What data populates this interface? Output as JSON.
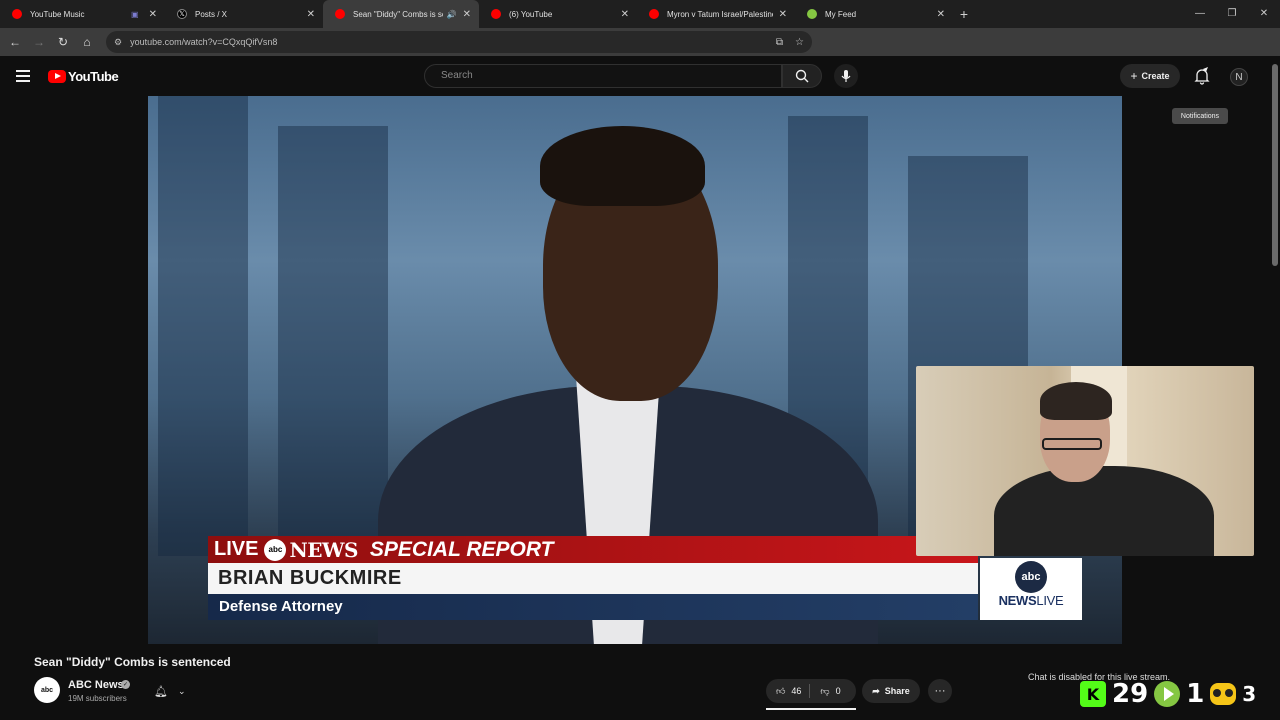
{
  "browser": {
    "tabs": [
      {
        "title": "YouTube Music",
        "icon": "youtube-music-icon",
        "color": "#ff0000",
        "active": false
      },
      {
        "title": "Posts / X",
        "icon": "x-icon",
        "color": "#ffffff",
        "active": false
      },
      {
        "title": "Sean \"Diddy\" Combs is sen",
        "icon": "youtube-icon",
        "color": "#ff0000",
        "active": true
      },
      {
        "title": "(6) YouTube",
        "icon": "youtube-icon",
        "color": "#ff0000",
        "active": false
      },
      {
        "title": "Myron v Tatum Israel/Palestine",
        "icon": "youtube-icon",
        "color": "#ff0000",
        "active": false
      },
      {
        "title": "My Feed",
        "icon": "rumble-icon",
        "color": "#85c742",
        "active": false
      }
    ],
    "url": "youtube.com/watch?v=CQxqQifVsn8"
  },
  "youtube": {
    "logo_text": "YouTube",
    "search_placeholder": "Search",
    "create_label": "Create",
    "avatar_letter": "N",
    "tooltip": "Notifications"
  },
  "video": {
    "lower_third": {
      "live": "LIVE",
      "abc": "abc",
      "news": "NEWS",
      "special": "SPECIAL REPORT",
      "name": "BRIAN BUCKMIRE",
      "role": "Defense Attorney",
      "badge_abc": "abc",
      "badge_news": "NEWS",
      "badge_live": "LIVE"
    }
  },
  "below": {
    "title": "Sean \"Diddy\" Combs is sentenced",
    "channel_avatar": "abc",
    "channel_name": "ABC News",
    "subscribers": "19M subscribers",
    "likes": "46",
    "dislikes": "0",
    "like_ratio": 1.0,
    "share_label": "Share",
    "chat_message": "Chat is disabled for this live stream.",
    "overlay": {
      "kick_count": "29",
      "rumble_count": "1",
      "third_count": "3"
    }
  },
  "colors": {
    "accent": "#ff0000",
    "bg": "#0f0f0f"
  }
}
